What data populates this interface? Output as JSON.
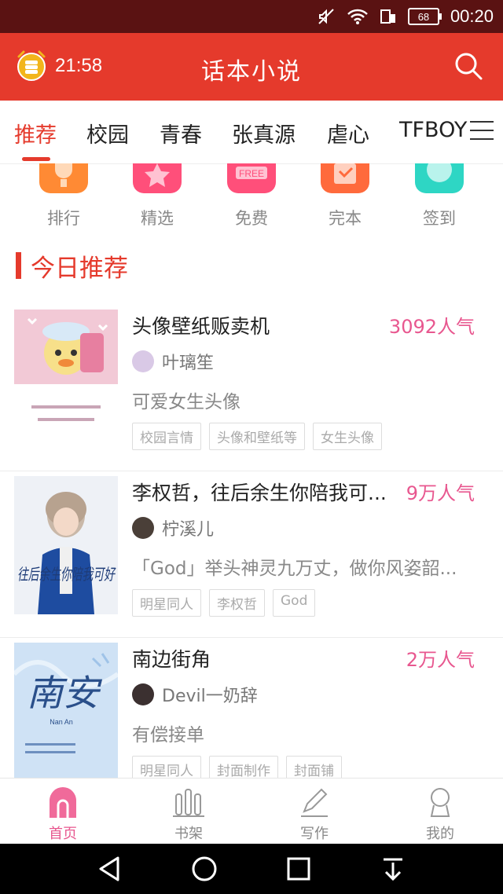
{
  "status_bar": {
    "battery": "68",
    "time": "00:20",
    "icons": [
      "mute-icon",
      "wifi-icon",
      "sim-icon",
      "battery-icon"
    ]
  },
  "header": {
    "alarm_time": "21:58",
    "title": "话本小说",
    "icons": [
      "alarm-clock-icon",
      "search-icon"
    ]
  },
  "tabs": [
    {
      "label": "推荐",
      "active": true
    },
    {
      "label": "校园"
    },
    {
      "label": "青春"
    },
    {
      "label": "张真源"
    },
    {
      "label": "虐心"
    },
    {
      "label": "TFBOY"
    }
  ],
  "quick_entries": [
    {
      "label": "排行",
      "icon": "trophy-icon",
      "color": "#ff8a34"
    },
    {
      "label": "精选",
      "icon": "star-icon",
      "color": "#ff4f7a"
    },
    {
      "label": "免费",
      "icon": "free-icon",
      "color": "#ff4f7a"
    },
    {
      "label": "完本",
      "icon": "check-icon",
      "color": "#ff6a3c"
    },
    {
      "label": "签到",
      "icon": "signin-icon",
      "color": "#2ed6c4"
    }
  ],
  "section": {
    "title": "今日推荐"
  },
  "books": [
    {
      "title": "头像壁纸贩卖机",
      "popularity": "3092人气",
      "author": "叶璃笙",
      "description": "可爱女生头像",
      "tags": [
        "校园言情",
        "头像和壁纸等",
        "女生头像"
      ],
      "cover": {
        "main_color": "#f2c9d6"
      }
    },
    {
      "title": "李权哲，往后余生你陪我可...",
      "popularity": "9万人气",
      "author": "柠溪儿",
      "description": "「God」举头神灵九万丈，做你风姿韶...",
      "tags": [
        "明星同人",
        "李权哲",
        "God"
      ],
      "cover": {
        "main_color": "#1e4ca0",
        "text": "往后余生你陪我可好"
      }
    },
    {
      "title": "南边街角",
      "popularity": "2万人气",
      "author": "Devil一奶辞",
      "description": "有偿接单",
      "tags": [
        "明星同人",
        "封面制作",
        "封面铺"
      ],
      "cover": {
        "main_color": "#cfe2f5",
        "text": "南安",
        "subtext": "Nan An"
      }
    }
  ],
  "bottom_nav": [
    {
      "label": "首页",
      "icon": "home-icon",
      "active": true
    },
    {
      "label": "书架",
      "icon": "bookshelf-icon"
    },
    {
      "label": "写作",
      "icon": "pencil-icon"
    },
    {
      "label": "我的",
      "icon": "profile-icon"
    }
  ],
  "system_nav": [
    "back-icon",
    "home-circle-icon",
    "recents-icon",
    "notification-down-icon"
  ],
  "colors": {
    "accent": "#e53a2c",
    "pink": "#e8578f",
    "status_bar": "#5a1212"
  }
}
